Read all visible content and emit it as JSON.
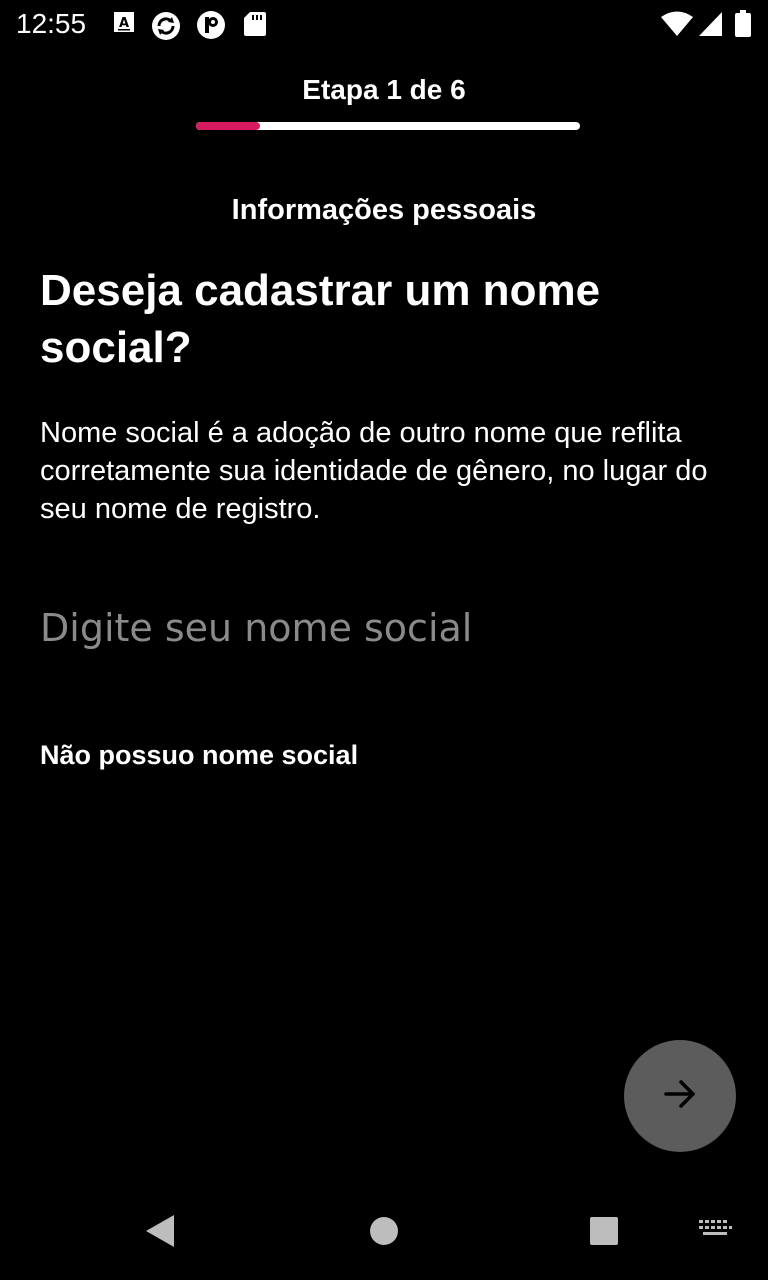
{
  "status_bar": {
    "time": "12:55",
    "left_icons": [
      "font-a-icon",
      "sync-icon",
      "p-circle-icon",
      "sd-card-icon"
    ],
    "right_icons": [
      "wifi-icon",
      "signal-icon",
      "battery-icon"
    ]
  },
  "header": {
    "step_label": "Etapa 1 de 6",
    "progress_fraction": 0.1667,
    "progress_color": "#d81b60",
    "track_color": "#ffffff"
  },
  "content": {
    "section_title": "Informações pessoais",
    "question": "Deseja cadastrar um nome social?",
    "description": "Nome social é a adoção de outro nome que reflita corretamente sua identidade de gênero, no lugar do seu nome de registro.",
    "input": {
      "value": "",
      "placeholder": "Digite seu nome social"
    },
    "no_social_name_label": "Não possuo nome social"
  },
  "actions": {
    "next_icon": "arrow-right-icon",
    "next_button_color": "#5c5c5c"
  },
  "nav_bar": {
    "icons": [
      "back-icon",
      "home-icon",
      "recents-icon",
      "keyboard-icon"
    ]
  }
}
